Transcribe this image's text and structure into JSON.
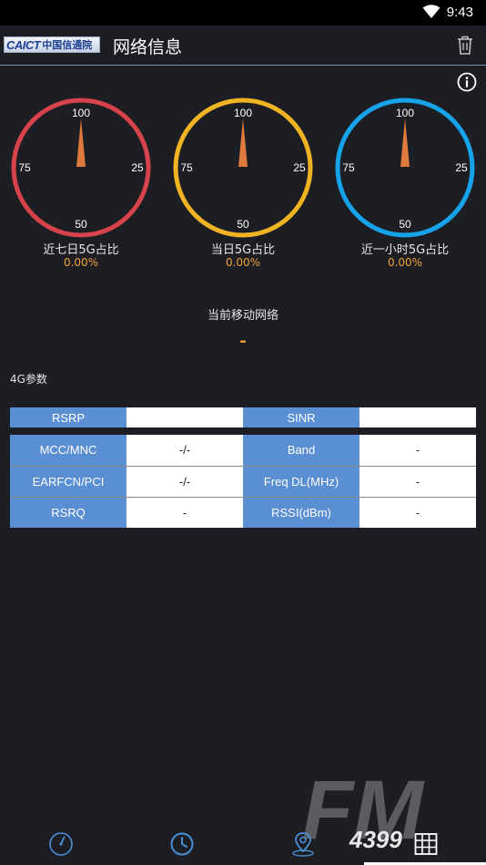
{
  "status_bar": {
    "time": "9:43"
  },
  "header": {
    "logo_text": "CAICT",
    "logo_cn": "中国信通院",
    "title": "网络信息"
  },
  "gauges": [
    {
      "label": "近七日5G占比",
      "value": "0.00%",
      "ticks": [
        "100",
        "75",
        "25",
        "50"
      ],
      "color": "#d6434b"
    },
    {
      "label": "当日5G占比",
      "value": "0.00%",
      "ticks": [
        "100",
        "75",
        "25",
        "50"
      ],
      "color": "#f0b323"
    },
    {
      "label": "近一小时5G占比",
      "value": "0.00%",
      "ticks": [
        "100",
        "75",
        "25",
        "50"
      ],
      "color": "#17a3ea"
    }
  ],
  "network": {
    "title": "当前移动网络",
    "value": "-"
  },
  "params_4g": {
    "title": "4G参数",
    "top_row": [
      {
        "label": "RSRP",
        "value": ""
      },
      {
        "label": "SINR",
        "value": ""
      }
    ],
    "rows": [
      {
        "label1": "MCC/MNC",
        "value1": "-/-",
        "label2": "Band",
        "value2": "-"
      },
      {
        "label1": "EARFCN/PCI",
        "value1": "-/-",
        "label2": "Freq DL(MHz)",
        "value2": "-"
      },
      {
        "label1": "RSRQ",
        "value1": "-",
        "label2": "RSSI(dBm)",
        "value2": "-"
      }
    ]
  },
  "watermark": {
    "text": "FM",
    "sub": "4399"
  },
  "bottom_nav": [
    "speedometer-icon",
    "clock-icon",
    "map-pin-icon",
    "grid-table-icon"
  ],
  "colors": {
    "accent": "#5a8fd4",
    "value_orange": "#f0a03a",
    "nav_blue": "#4a8fd6"
  }
}
